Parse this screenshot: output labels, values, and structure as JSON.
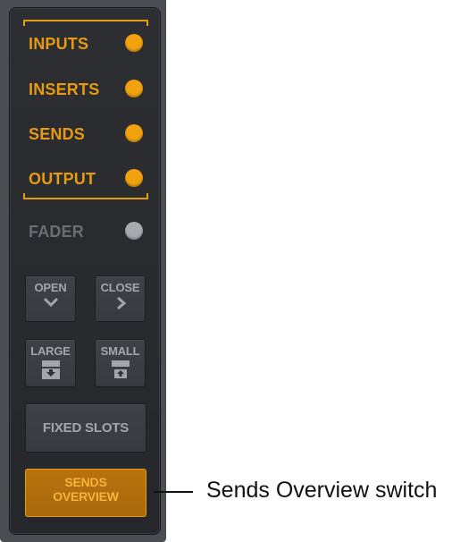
{
  "colors": {
    "accent": "#e79a12",
    "dot_on": "#f2a20e",
    "dot_off": "#a7abb0",
    "label_off": "#6a6e73",
    "panel": "#2a2c2f"
  },
  "view_rows": [
    {
      "label": "INPUTS",
      "state": "on"
    },
    {
      "label": "INSERTS",
      "state": "on"
    },
    {
      "label": "SENDS",
      "state": "on"
    },
    {
      "label": "OUTPUT",
      "state": "on"
    },
    {
      "label": "FADER",
      "state": "off"
    }
  ],
  "buttons": {
    "open": {
      "label": "OPEN",
      "icon": "chevron-down-icon"
    },
    "close": {
      "label": "CLOSE",
      "icon": "chevron-right-icon"
    },
    "large": {
      "label": "LARGE",
      "icon": "large-slot-icon"
    },
    "small": {
      "label": "SMALL",
      "icon": "small-slot-icon"
    },
    "fixed_slots": {
      "label": "FIXED SLOTS"
    },
    "sends_overview": {
      "line1": "SENDS",
      "line2": "OVERVIEW",
      "state": "on"
    }
  },
  "callout": {
    "text": "Sends Overview switch"
  }
}
